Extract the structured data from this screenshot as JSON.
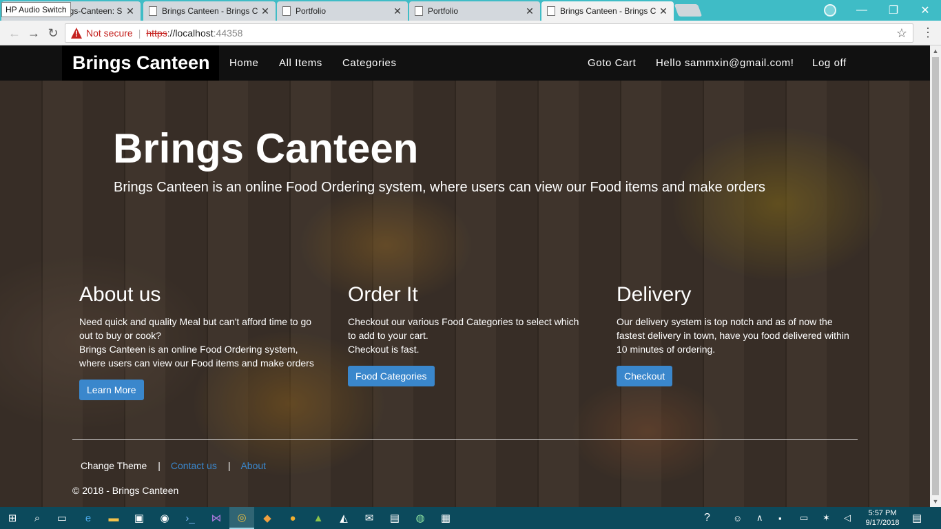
{
  "browser": {
    "hp_audio_label": "HP Audio Switch",
    "tabs": [
      {
        "label": "ngs-Canteen: S",
        "active": false
      },
      {
        "label": "Brings Canteen - Brings C",
        "active": false
      },
      {
        "label": "Portfolio",
        "active": false
      },
      {
        "label": "Portfolio",
        "active": false
      },
      {
        "label": "Brings Canteen - Brings C",
        "active": true
      }
    ],
    "address": {
      "security_label": "Not secure",
      "protocol": "https",
      "host": "://localhost",
      "port": ":44358"
    },
    "window_controls": {
      "minimize": "—",
      "maximize": "❐",
      "close": "✕"
    }
  },
  "navbar": {
    "brand": "Brings Canteen",
    "links": [
      "Home",
      "All Items",
      "Categories"
    ],
    "right_links": [
      "Goto Cart",
      "Hello sammxin@gmail.com!",
      "Log off"
    ]
  },
  "jumbotron": {
    "title": "Brings Canteen",
    "lead": "Brings Canteen is an online Food Ordering system, where users can view our Food items and make orders"
  },
  "columns": [
    {
      "heading": "About us",
      "lines": [
        "Need quick and quality Meal but can't afford time to go out to buy or cook?",
        "Brings Canteen is an online Food Ordering system, where users can view our Food items and make orders"
      ],
      "button": "Learn More"
    },
    {
      "heading": "Order It",
      "lines": [
        "Checkout our various Food Categories to select which to add to your cart.",
        "Checkout is fast."
      ],
      "button": "Food Categories"
    },
    {
      "heading": "Delivery",
      "lines": [
        "Our delivery system is top notch and as of now the fastest delivery in town, have you food delivered within 10 minutes of ordering."
      ],
      "button": "Checkout"
    }
  ],
  "footer": {
    "change_theme": "Change Theme",
    "separator": "|",
    "contact": "Contact us",
    "about": "About",
    "copyright": "© 2018 - Brings Canteen"
  },
  "taskbar": {
    "time": "5:57 PM",
    "date": "9/17/2018"
  },
  "colors": {
    "navbar_bg": "#111111",
    "button_bg": "#3a87cc",
    "link": "#3a87cc",
    "tabbar_bg": "#3fbcc6",
    "taskbar_bg": "#0c4a5c"
  }
}
